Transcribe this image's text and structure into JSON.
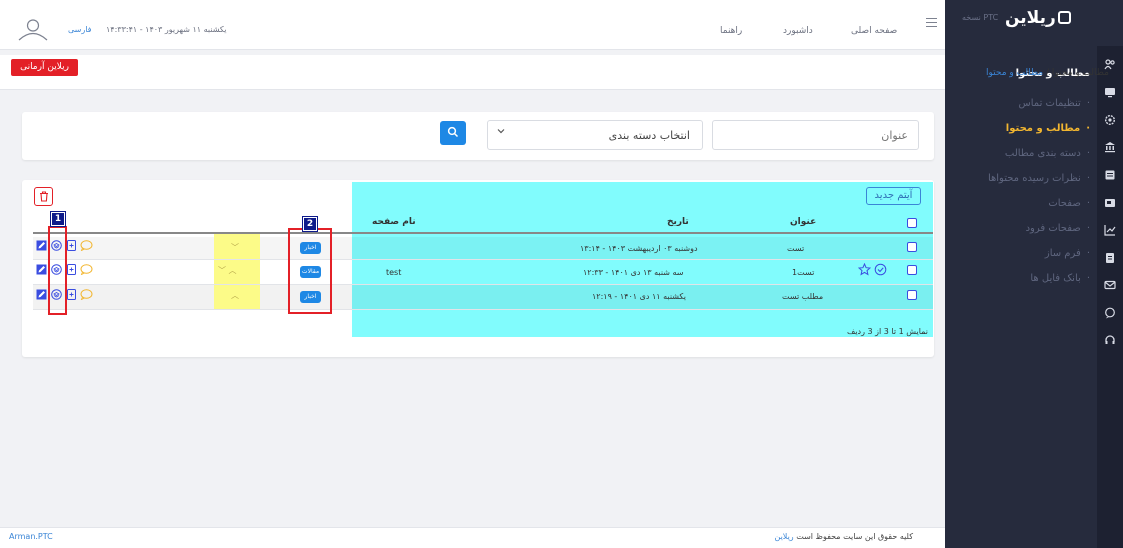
{
  "sidebar": {
    "logo": "ریلاین",
    "version": "نسخه PTC",
    "title": "مطالب و محتوا",
    "items": [
      {
        "label": "تنظیمات تماس",
        "active": false
      },
      {
        "label": "مطالب و محتوا",
        "active": true
      },
      {
        "label": "دسته بندی مطالب",
        "active": false
      },
      {
        "label": "نظرات رسیده محتواها",
        "active": false
      },
      {
        "label": "صفحات",
        "active": false
      },
      {
        "label": "صفحات فرود",
        "active": false
      },
      {
        "label": "فرم ساز",
        "active": false
      },
      {
        "label": "بانک فایل ها",
        "active": false
      }
    ],
    "rail_icons": [
      "users-icon",
      "monitor-icon",
      "settings-icon",
      "bank-icon",
      "list-icon",
      "media-icon",
      "chart-icon",
      "file-icon",
      "mail-icon",
      "chat-icon",
      "headset-icon"
    ]
  },
  "header": {
    "nav": [
      "صفحه اصلی",
      "داشبورد",
      "راهنما"
    ],
    "datetime": "یکشنبه ۱۱ شهریور ۱۴۰۳ - ۱۴:۳۳:۴۱",
    "language": "فارسی"
  },
  "breadcrumb": {
    "root": "مطالب و محتوا",
    "separator": "/",
    "current": "مطالب و محتوا"
  },
  "top_button": "ریلاین آرمانی",
  "filters": {
    "title_placeholder": "عنوان",
    "category_label": "انتخاب دسته بندی"
  },
  "table": {
    "new_item": "آیتم جدید",
    "columns": {
      "title": "عنوان",
      "date": "تاریخ",
      "page_name": "نام صفحه"
    },
    "rows": [
      {
        "title": "تست",
        "date": "دوشنبه ۰۳ اردیبهشت ۱۴۰۳ - ۱۳:۱۴",
        "page_name": "",
        "badge": "اخبار",
        "chevrons": "﹀"
      },
      {
        "title": "تست1",
        "date": "سه شنبه ۱۳ دی ۱۴۰۱ - ۱۲:۳۳",
        "page_name": "test",
        "badge": "مقالات",
        "chevrons": "﹀ ︿"
      },
      {
        "title": "مطلب تست",
        "date": "یکشنبه ۱۱ دی ۱۴۰۱ - ۱۲:۱۹",
        "page_name": "",
        "badge": "اخبار",
        "chevrons": "︿"
      }
    ],
    "info": "نمایش 1 تا 3 از 3 ردیف"
  },
  "annotations": {
    "marker1": "1",
    "marker2": "2"
  },
  "footer": {
    "brand": "Arman.PTC",
    "copyright_prefix": "کلیه حقوق این سایت محفوظ است",
    "copyright_link": "ریلاین"
  },
  "colors": {
    "sidebar": "#262b3d",
    "accent": "#f2b630",
    "primary": "#1e88e5",
    "danger": "#e32027",
    "highlight_cyan": "#81fcfd",
    "highlight_yellow": "#fcfb88"
  }
}
